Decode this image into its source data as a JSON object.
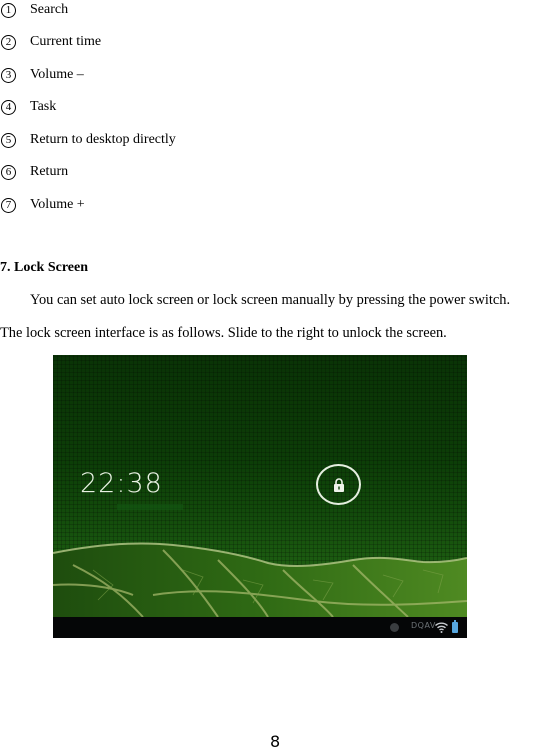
{
  "legend": [
    {
      "num": "1",
      "label": "Search"
    },
    {
      "num": "2",
      "label": "Current time"
    },
    {
      "num": "3",
      "label": "Volume –"
    },
    {
      "num": "4",
      "label": "Task"
    },
    {
      "num": "5",
      "label": "Return to desktop directly"
    },
    {
      "num": "6",
      "label": "Return"
    },
    {
      "num": "7",
      "label": "Volume +"
    }
  ],
  "section": {
    "heading": "7. Lock Screen",
    "para_line1": "You can set auto lock screen or lock screen manually by pressing the power switch.",
    "para_line2": "The lock screen interface is as follows. Slide to the right to unlock the screen."
  },
  "lock_screen": {
    "time": "22:38",
    "lock_icon": "padlock-icon",
    "status_text": "DQAV",
    "status_icons": [
      "notification-dot-icon",
      "wifi-icon",
      "battery-icon"
    ],
    "colors": {
      "background": "#0c3d07",
      "leaf": "#3d7a1a",
      "navbar": "#050607",
      "battery": "#58a8e0",
      "ring": "#e6efe0"
    }
  },
  "page_number": "8"
}
